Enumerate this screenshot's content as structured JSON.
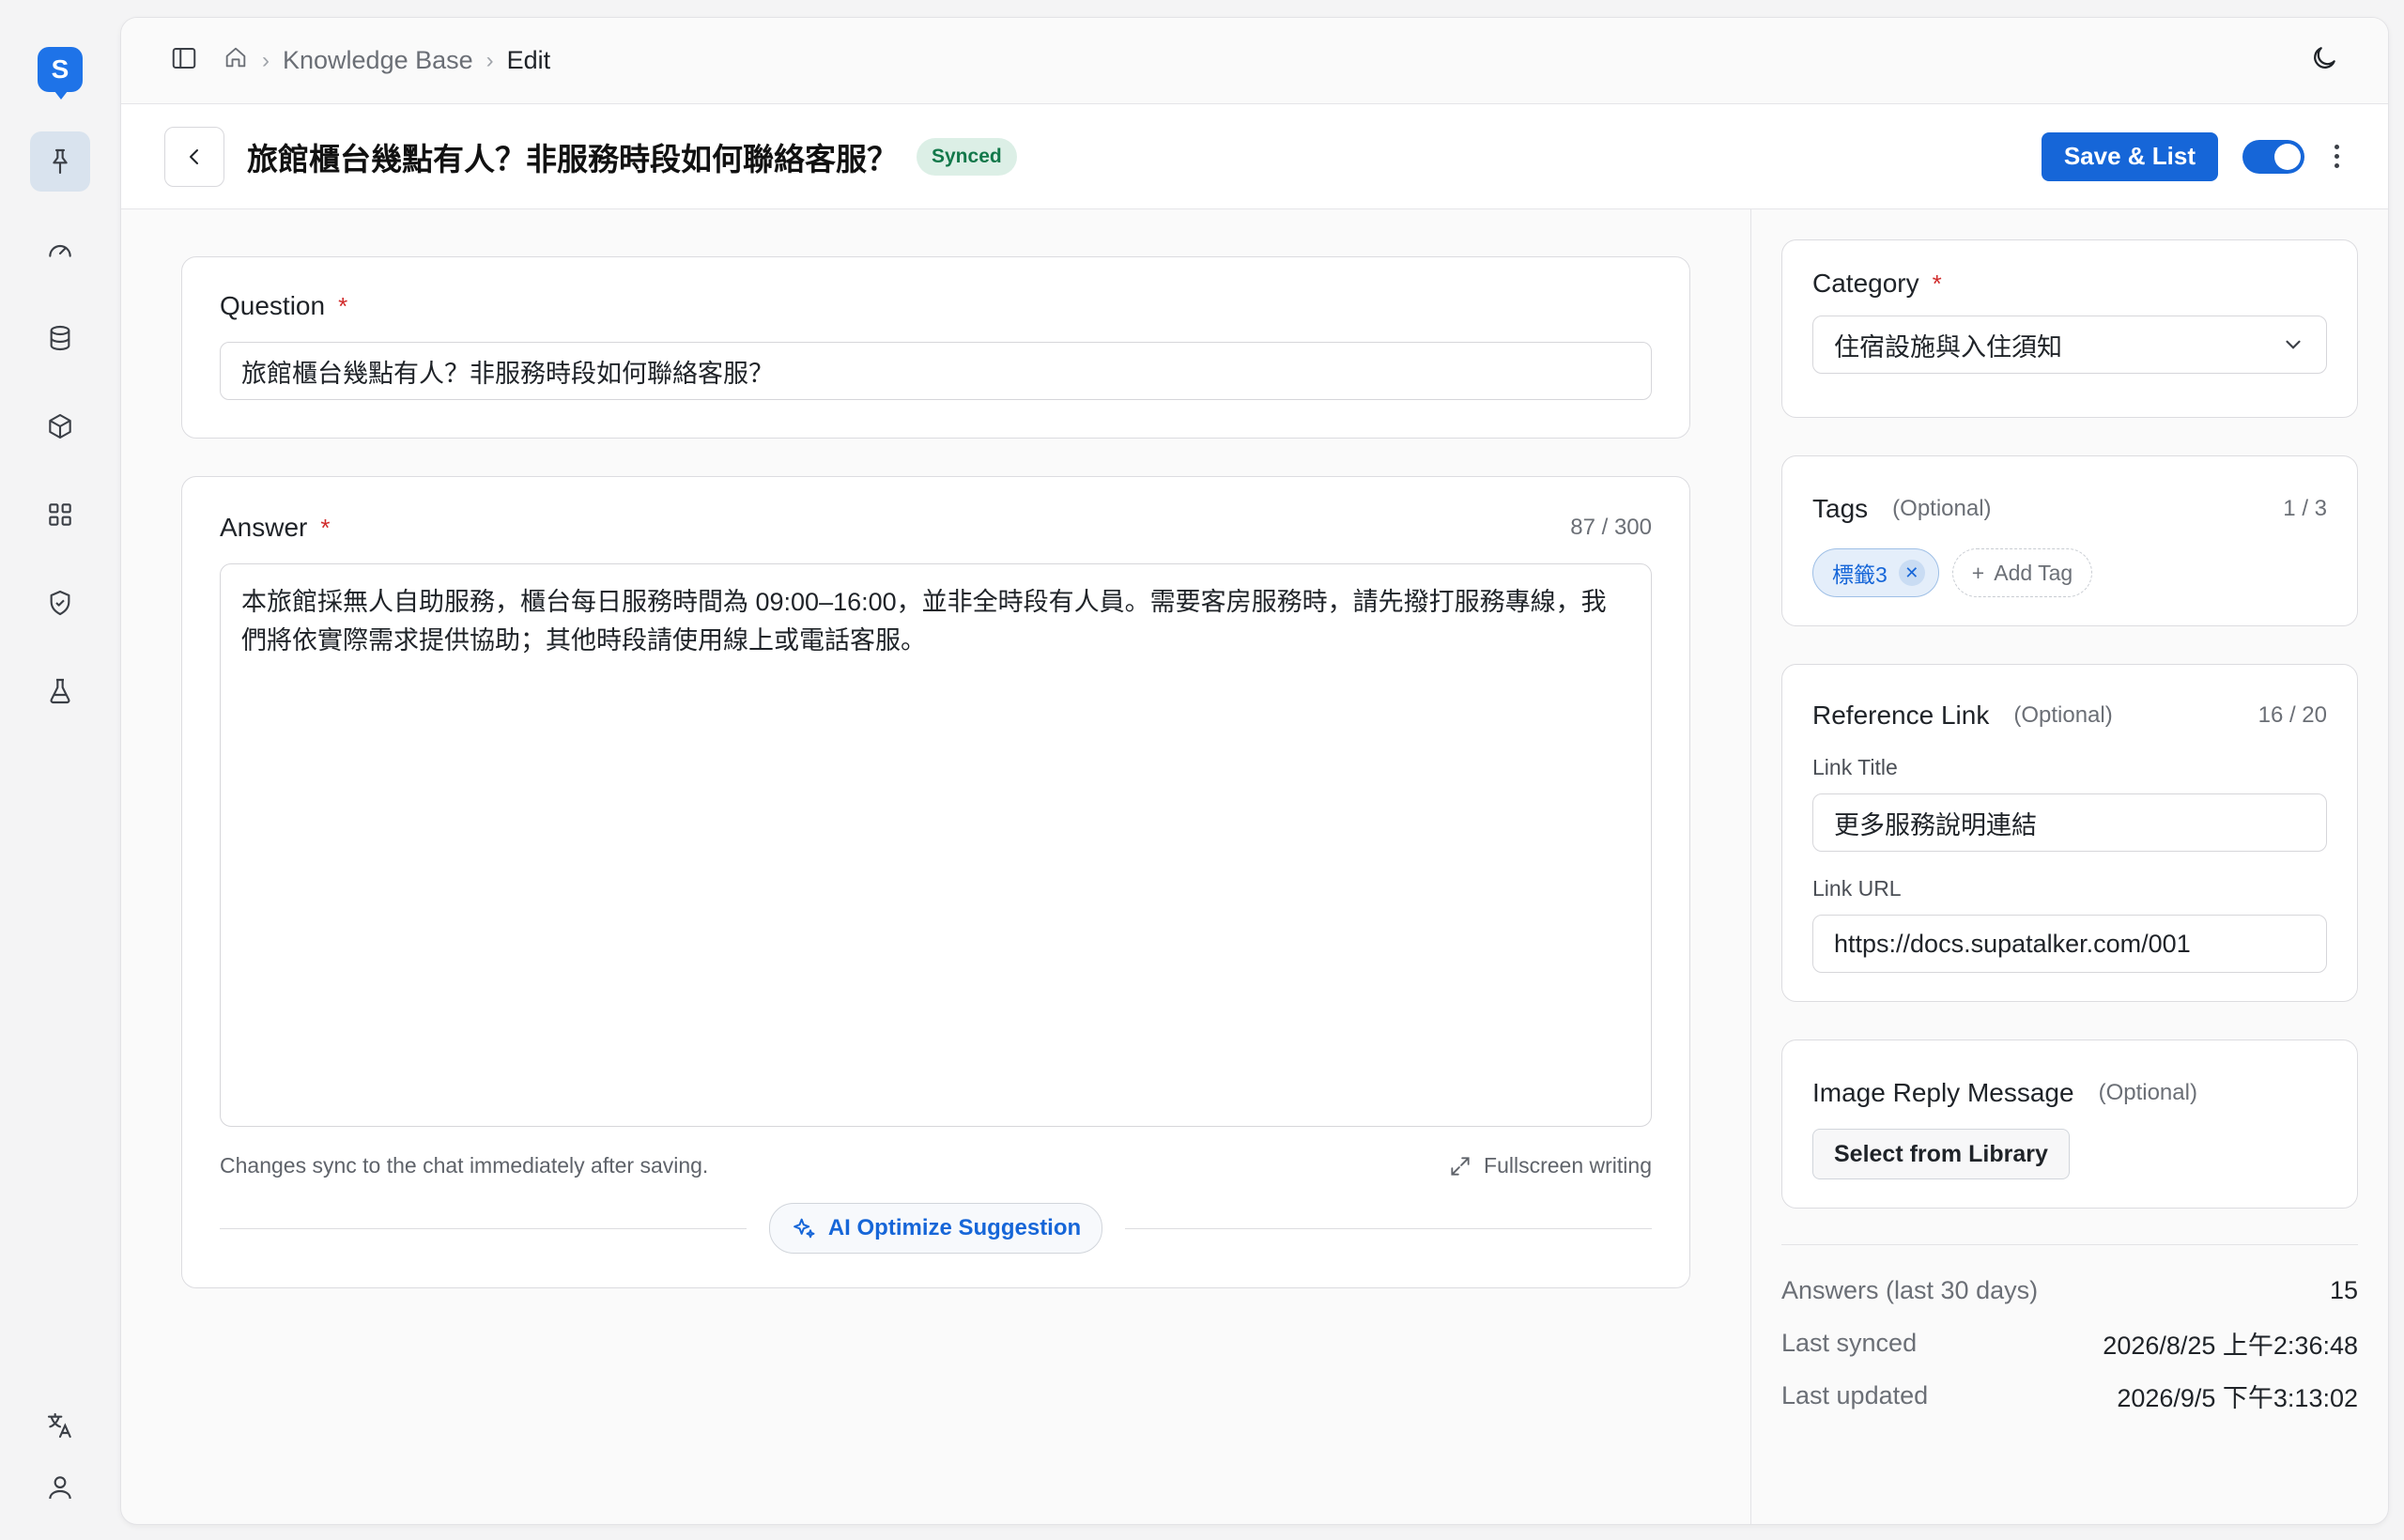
{
  "app": {
    "logo_letter": "S"
  },
  "breadcrumb": {
    "items": [
      "Knowledge Base",
      "Edit"
    ]
  },
  "title_bar": {
    "title": "旅館櫃台幾點有人？非服務時段如何聯絡客服？",
    "status": "Synced",
    "save_label": "Save & List",
    "enabled": true
  },
  "question": {
    "label": "Question",
    "required_mark": "*",
    "value": "旅館櫃台幾點有人？非服務時段如何聯絡客服？"
  },
  "answer": {
    "label": "Answer",
    "required_mark": "*",
    "counter": "87 / 300",
    "value": "本旅館採無人自助服務，櫃台每日服務時間為 09:00–16:00，並非全時段有人員。需要客房服務時，請先撥打服務專線，我們將依實際需求提供協助；其他時段請使用線上或電話客服。",
    "helper": "Changes sync to the chat immediately after saving.",
    "fullscreen_label": "Fullscreen writing",
    "ai_label": "AI Optimize Suggestion"
  },
  "category": {
    "label": "Category",
    "required_mark": "*",
    "value": "住宿設施與入住須知"
  },
  "tags": {
    "label": "Tags",
    "optional": "(Optional)",
    "counter": "1 / 3",
    "items": [
      "標籤3"
    ],
    "add_label": "Add Tag"
  },
  "reference_link": {
    "label": "Reference Link",
    "optional": "(Optional)",
    "counter": "16 / 20",
    "title_label": "Link Title",
    "title_value": "更多服務說明連結",
    "url_label": "Link URL",
    "url_value": "https://docs.supatalker.com/001"
  },
  "image_reply": {
    "label": "Image Reply Message",
    "optional": "(Optional)",
    "button": "Select from Library"
  },
  "stats": [
    {
      "key": "Answers (last 30 days)",
      "value": "15"
    },
    {
      "key": "Last synced",
      "value": "2026/8/25 上午2:36:48"
    },
    {
      "key": "Last updated",
      "value": "2026/9/5 下午3:13:02"
    }
  ]
}
